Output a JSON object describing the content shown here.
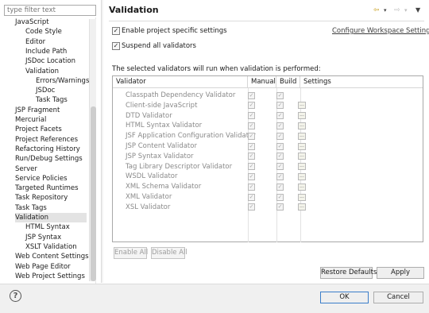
{
  "filter": {
    "placeholder": "type filter text"
  },
  "tree": {
    "items": [
      {
        "label": "JavaScript",
        "selected": false
      },
      {
        "label": "Code Style",
        "selected": false
      },
      {
        "label": "Editor",
        "selected": false
      },
      {
        "label": "Include Path",
        "selected": false
      },
      {
        "label": "JSDoc Location",
        "selected": false
      },
      {
        "label": "Validation",
        "selected": false
      },
      {
        "label": "Errors/Warnings",
        "selected": false
      },
      {
        "label": "JSDoc",
        "selected": false
      },
      {
        "label": "Task Tags",
        "selected": false
      },
      {
        "label": "JSP Fragment",
        "selected": false
      },
      {
        "label": "Mercurial",
        "selected": false
      },
      {
        "label": "Project Facets",
        "selected": false
      },
      {
        "label": "Project References",
        "selected": false
      },
      {
        "label": "Refactoring History",
        "selected": false
      },
      {
        "label": "Run/Debug Settings",
        "selected": false
      },
      {
        "label": "Server",
        "selected": false
      },
      {
        "label": "Service Policies",
        "selected": false
      },
      {
        "label": "Targeted Runtimes",
        "selected": false
      },
      {
        "label": "Task Repository",
        "selected": false
      },
      {
        "label": "Task Tags",
        "selected": false
      },
      {
        "label": "Validation",
        "selected": true
      },
      {
        "label": "HTML Syntax",
        "selected": false
      },
      {
        "label": "JSP Syntax",
        "selected": false
      },
      {
        "label": "XSLT Validation",
        "selected": false
      },
      {
        "label": "Web Content Settings",
        "selected": false
      },
      {
        "label": "Web Page Editor",
        "selected": false
      },
      {
        "label": "Web Project Settings",
        "selected": false
      }
    ]
  },
  "header": {
    "title": "Validation",
    "icons": [
      "back-arrow-icon",
      "dropdown-icon",
      "forward-arrow-icon",
      "dropdown-icon",
      "view-menu-icon"
    ]
  },
  "options": {
    "enable_project_label": "Enable project specific settings",
    "enable_project_checked": true,
    "configure_link": "Configure Workspace Settings...",
    "suspend_label": "Suspend all validators",
    "suspend_checked": true,
    "info_text": "The selected validators will run when validation is performed:"
  },
  "table": {
    "headers": [
      "Validator",
      "Manual",
      "Build",
      "Settings"
    ],
    "rows": [
      {
        "name": "Classpath Dependency Validator",
        "manual": true,
        "build": true,
        "settings": false
      },
      {
        "name": "Client-side JavaScript",
        "manual": true,
        "build": true,
        "settings": true
      },
      {
        "name": "DTD Validator",
        "manual": true,
        "build": true,
        "settings": true
      },
      {
        "name": "HTML Syntax Validator",
        "manual": true,
        "build": true,
        "settings": true
      },
      {
        "name": "JSF Application Configuration Validator",
        "manual": true,
        "build": true,
        "settings": true
      },
      {
        "name": "JSP Content Validator",
        "manual": true,
        "build": true,
        "settings": true
      },
      {
        "name": "JSP Syntax Validator",
        "manual": true,
        "build": true,
        "settings": true
      },
      {
        "name": "Tag Library Descriptor Validator",
        "manual": true,
        "build": true,
        "settings": true
      },
      {
        "name": "WSDL Validator",
        "manual": true,
        "build": true,
        "settings": true
      },
      {
        "name": "XML Schema Validator",
        "manual": true,
        "build": true,
        "settings": true
      },
      {
        "name": "XML Validator",
        "manual": true,
        "build": true,
        "settings": true
      },
      {
        "name": "XSL Validator",
        "manual": true,
        "build": true,
        "settings": true
      }
    ],
    "settings_button_glyph": "..."
  },
  "buttons": {
    "enable_all": "Enable All",
    "disable_all": "Disable All",
    "restore_defaults": "Restore Defaults",
    "apply": "Apply",
    "ok": "OK",
    "cancel": "Cancel"
  },
  "help": {
    "glyph": "?"
  }
}
